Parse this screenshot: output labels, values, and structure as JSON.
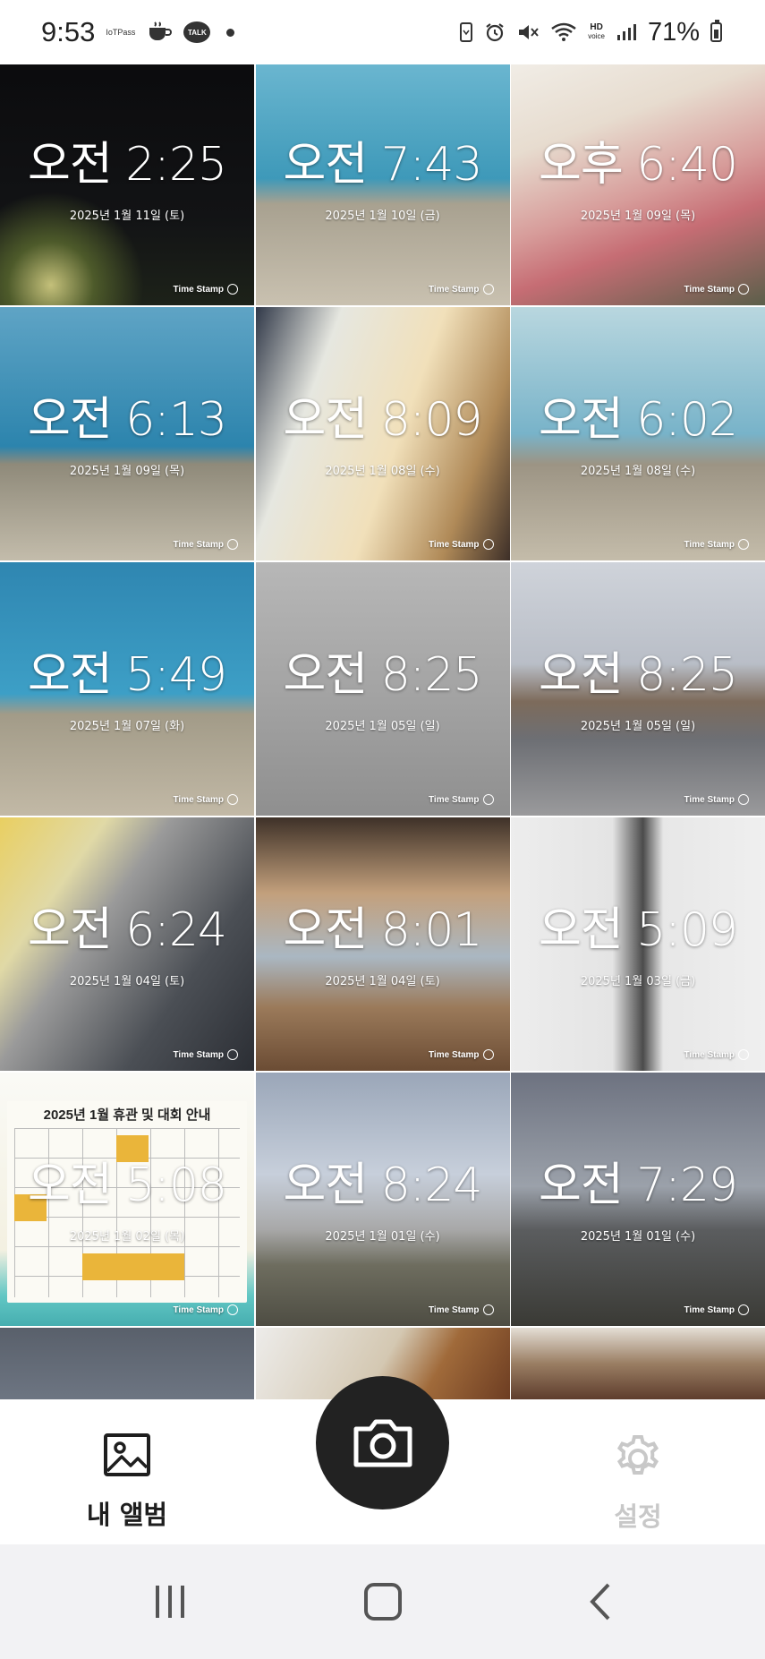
{
  "status_bar": {
    "time": "9:53",
    "app_icons": [
      "iot-pass",
      "coffee-cup",
      "kakaotalk"
    ],
    "talk_label": "TALK",
    "iot_label": "IoTPass",
    "hd_label_top": "HD",
    "hd_label_bottom": "voice",
    "battery": "71%"
  },
  "photos": [
    {
      "time": "오전 2:25",
      "date": "2025년 1월 11일 (토)",
      "stamp": "Time Stamp"
    },
    {
      "time": "오전 7:43",
      "date": "2025년 1월 10일 (금)",
      "stamp": "Time Stamp"
    },
    {
      "time": "오후 6:40",
      "date": "2025년 1월 09일 (목)",
      "stamp": "Time Stamp"
    },
    {
      "time": "오전 6:13",
      "date": "2025년 1월 09일 (목)",
      "stamp": "Time Stamp"
    },
    {
      "time": "오전 8:09",
      "date": "2025년 1월 08일 (수)",
      "stamp": "Time Stamp"
    },
    {
      "time": "오전 6:02",
      "date": "2025년 1월 08일 (수)",
      "stamp": "Time Stamp"
    },
    {
      "time": "오전 5:49",
      "date": "2025년 1월 07일 (화)",
      "stamp": "Time Stamp"
    },
    {
      "time": "오전 8:25",
      "date": "2025년 1월 05일 (일)",
      "stamp": "Time Stamp"
    },
    {
      "time": "오전 8:25",
      "date": "2025년 1월 05일 (일)",
      "stamp": "Time Stamp"
    },
    {
      "time": "오전 6:24",
      "date": "2025년 1월 04일 (토)",
      "stamp": "Time Stamp"
    },
    {
      "time": "오전 8:01",
      "date": "2025년 1월 04일 (토)",
      "stamp": "Time Stamp"
    },
    {
      "time": "오전 5:09",
      "date": "2025년 1월 03일 (금)",
      "stamp": "Time Stamp"
    },
    {
      "time": "오전 5:08",
      "date": "2025년 1월 02일 (목)",
      "stamp": "Time Stamp"
    },
    {
      "time": "오전 8:24",
      "date": "2025년 1월 01일 (수)",
      "stamp": "Time Stamp"
    },
    {
      "time": "오전 7:29",
      "date": "2025년 1월 01일 (수)",
      "stamp": "Time Stamp"
    }
  ],
  "calendar_photo": {
    "title": "2025년 1월 휴관 및 대회 안내"
  },
  "bottom_nav": {
    "album_label": "내 앨범",
    "settings_label": "설정",
    "album_icon": "image-icon",
    "camera_icon": "camera-icon",
    "settings_icon": "gear-icon",
    "active_color": "#1e1e1e",
    "inactive_color": "#c8c8c8",
    "fab_color": "#222222"
  },
  "system_nav": {
    "buttons": [
      "recent-apps",
      "home",
      "back"
    ]
  }
}
